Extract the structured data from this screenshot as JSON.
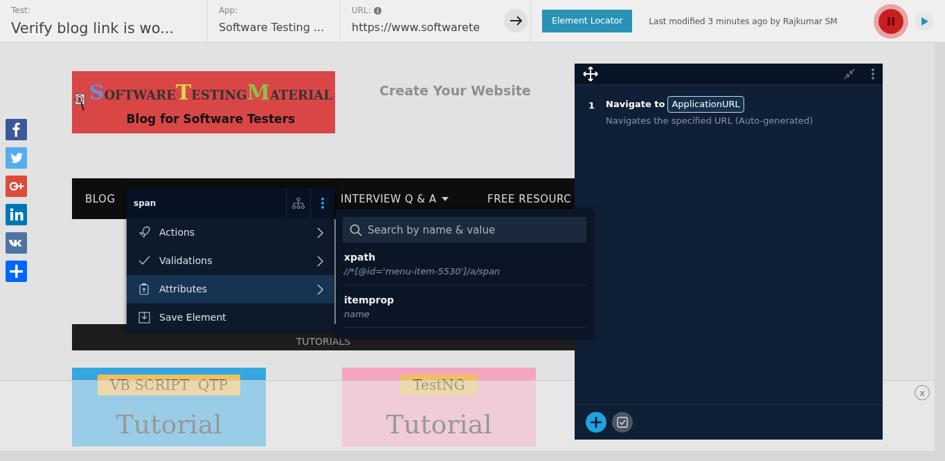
{
  "toolbar": {
    "fields": [
      {
        "label": "Test:",
        "value": "Verify blog link is wo..."
      },
      {
        "label": "App:",
        "value": "Software Testing ..."
      },
      {
        "label": "URL:",
        "value": "https://www.softwarete",
        "info": true
      }
    ],
    "locator_button": "Element Locator",
    "last_modified": "Last modified 3 minutes ago by Rajkumar SM"
  },
  "website": {
    "logo": {
      "words": [
        "S",
        "OFTWARE",
        "T",
        "ESTING",
        "M",
        "ATERIAL"
      ],
      "tagline": "Blog for Software Testers"
    },
    "ad_heading": "Create Your Website",
    "social": [
      {
        "kind": "facebook",
        "color": "#3b5998"
      },
      {
        "kind": "twitter",
        "color": "#55acee"
      },
      {
        "kind": "googleplus",
        "color": "#dd4b39"
      },
      {
        "kind": "linkedin",
        "color": "#0077b5"
      },
      {
        "kind": "vk",
        "color": "#4c75a3"
      },
      {
        "kind": "share",
        "color": "#0166ff"
      }
    ],
    "nav": [
      {
        "label": "BLOG",
        "dropdown": false
      },
      {
        "label": "INTERVIEW Q & A",
        "dropdown": true
      },
      {
        "label": "FREE RESOURC",
        "dropdown": false
      }
    ],
    "section_label": "TUTORIALS",
    "thumbnails": [
      {
        "title": "VB SCRIPT  QTP",
        "subtitle": "Tutorial",
        "color": "#35a7e0"
      },
      {
        "title": "TestNG",
        "subtitle": "Tutorial",
        "color": "#f4a6c0"
      }
    ],
    "ad_close": "x"
  },
  "element_menu": {
    "tag": "span",
    "items": [
      {
        "label": "Actions",
        "kind": "actions",
        "selected": false
      },
      {
        "label": "Validations",
        "kind": "validations",
        "selected": false
      },
      {
        "label": "Attributes",
        "kind": "attributes",
        "selected": true
      },
      {
        "label": "Save Element",
        "kind": "save",
        "selected": false
      }
    ]
  },
  "attributes": {
    "placeholder": "Search by name & value",
    "items": [
      {
        "name": "xpath",
        "value": "//*[@id='menu-item-5530']/a/span"
      },
      {
        "name": "itemprop",
        "value": "name"
      }
    ]
  },
  "steps_panel": {
    "steps": [
      {
        "number": "1",
        "action": "Navigate to",
        "param": "ApplicationURL",
        "description": "Navigates the specified URL (Auto-generated)"
      }
    ]
  }
}
